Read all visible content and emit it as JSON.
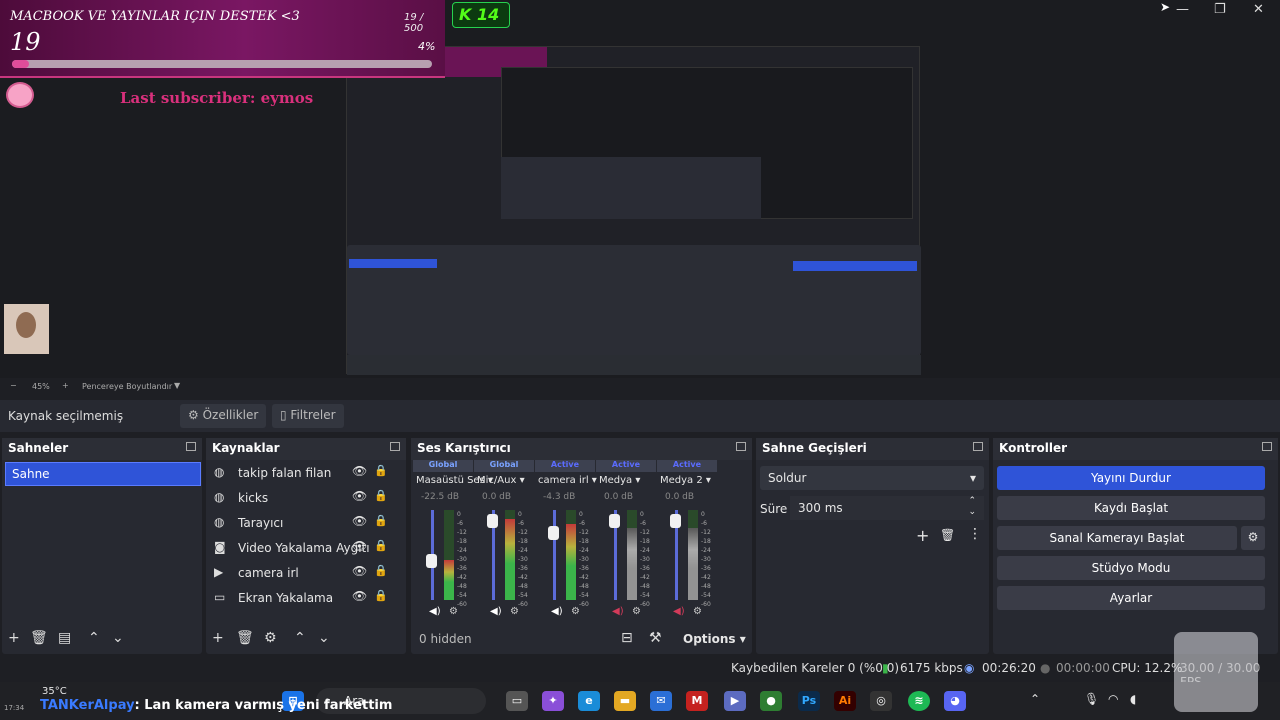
{
  "goal": {
    "title": "MACBOOK VE YAYINLAR IÇIN DESTEK <3",
    "count": "19 / 500",
    "current": "19",
    "percent": "4%",
    "fraction": 0.04
  },
  "kick": {
    "label": "14"
  },
  "last_sub": "Last subscriber: eymos",
  "zoombar": {
    "minus": "−",
    "zoom": "45%",
    "plus": "+",
    "fit": "Pencereye Boyutlandır"
  },
  "source_bar": {
    "label": "Kaynak seçilmemiş",
    "properties": "Özellikler",
    "filters": "Filtreler"
  },
  "scenes": {
    "title": "Sahneler",
    "items": [
      "Sahne"
    ]
  },
  "sources": {
    "title": "Kaynaklar",
    "items": [
      {
        "name": "takip falan filan",
        "icon": "globe-icon"
      },
      {
        "name": "kicks",
        "icon": "globe-icon"
      },
      {
        "name": "Tarayıcı",
        "icon": "globe-icon"
      },
      {
        "name": "Video Yakalama Aygıtı",
        "icon": "camera-icon"
      },
      {
        "name": "camera irl",
        "icon": "play-icon"
      },
      {
        "name": "Ekran Yakalama",
        "icon": "monitor-icon"
      }
    ]
  },
  "mixer": {
    "title": "Ses Karıştırıcı",
    "hidden": "0 hidden",
    "options": "Options",
    "ticks": [
      "0",
      "-6",
      "-12",
      "-18",
      "-24",
      "-30",
      "-36",
      "-42",
      "-48",
      "-54",
      "-60"
    ],
    "channels": [
      {
        "state": "Global",
        "name": "Masaüstü Ses",
        "db": "-22.5 dB",
        "muted": false,
        "level": 0.45,
        "fader": 0.45
      },
      {
        "state": "Global",
        "name": "Mic/Aux",
        "db": "0.0 dB",
        "muted": false,
        "level": 0.9,
        "fader": 0.95
      },
      {
        "state": "Active",
        "name": "camera irl",
        "db": "-4.3 dB",
        "muted": false,
        "level": 0.85,
        "fader": 0.8
      },
      {
        "state": "Active",
        "name": "Medya",
        "db": "0.0 dB",
        "muted": true,
        "level": 0.8,
        "fader": 0.95
      },
      {
        "state": "Active",
        "name": "Medya 2",
        "db": "0.0 dB",
        "muted": true,
        "level": 0.8,
        "fader": 0.95
      }
    ]
  },
  "transitions": {
    "title": "Sahne Geçişleri",
    "selected": "Soldur",
    "duration_label": "Süre",
    "duration": "300 ms"
  },
  "controls": {
    "title": "Kontroller",
    "buttons": [
      "Yayını Durdur",
      "Kaydı Başlat",
      "Sanal Kamerayı Başlat",
      "Stüdyo Modu",
      "Ayarlar"
    ]
  },
  "status": {
    "dropped": "Kaybedilen Kareler 0 (%0.0)",
    "bitrate": "6175 kbps",
    "live_time": "00:26:20",
    "rec_time": "00:00:00",
    "cpu": "CPU: 12.2%",
    "fps": "30.00 / 30.00 FPS"
  },
  "taskbar": {
    "temp": "35°C",
    "search": "Ara",
    "time": "17:34"
  },
  "chat": {
    "user": "TANKerAlpay",
    "message": ": Lan kamera varmış yeni farkettim"
  },
  "colors": {
    "accent": "#2f54d8",
    "goal_fill": "#e04d9a",
    "kick": "#53fc18",
    "subscriber": "#d9307c"
  }
}
